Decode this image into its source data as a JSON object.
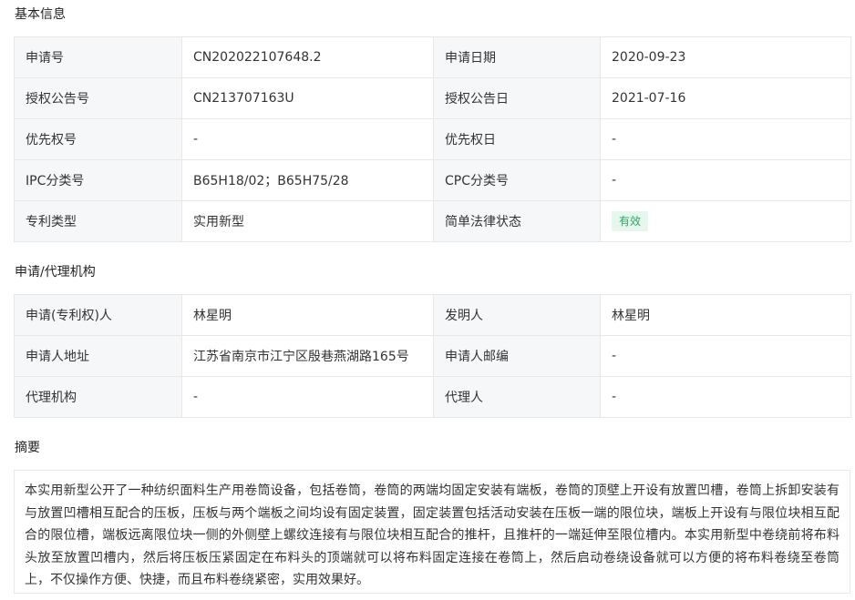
{
  "basic_info": {
    "title": "基本信息",
    "rows": [
      [
        {
          "label": "申请号",
          "value": "CN202022107648.2"
        },
        {
          "label": "申请日期",
          "value": "2020-09-23"
        }
      ],
      [
        {
          "label": "授权公告号",
          "value": "CN213707163U"
        },
        {
          "label": "授权公告日",
          "value": "2021-07-16"
        }
      ],
      [
        {
          "label": "优先权号",
          "value": "-"
        },
        {
          "label": "优先权日",
          "value": "-"
        }
      ],
      [
        {
          "label": "IPC分类号",
          "value": "B65H18/02；B65H75/28"
        },
        {
          "label": "CPC分类号",
          "value": "-"
        }
      ],
      [
        {
          "label": "专利类型",
          "value": "实用新型"
        },
        {
          "label": "简单法律状态",
          "value": "有效"
        }
      ]
    ]
  },
  "agency_info": {
    "title": "申请/代理机构",
    "rows": [
      [
        {
          "label": "申请(专利权)人",
          "value": "林星明"
        },
        {
          "label": "发明人",
          "value": "林星明"
        }
      ],
      [
        {
          "label": "申请人地址",
          "value": "江苏省南京市江宁区殷巷燕湖路165号"
        },
        {
          "label": "申请人邮编",
          "value": "-"
        }
      ],
      [
        {
          "label": "代理机构",
          "value": "-"
        },
        {
          "label": "代理人",
          "value": "-"
        }
      ]
    ]
  },
  "abstract": {
    "title": "摘要",
    "text": "本实用新型公开了一种纺织面料生产用卷筒设备，包括卷筒，卷筒的两端均固定安装有端板，卷筒的顶壁上开设有放置凹槽，卷筒上拆卸安装有与放置凹槽相互配合的压板，压板与两个端板之间均设有固定装置，固定装置包括活动安装在压板一端的限位块，端板上开设有与限位块相互配合的限位槽，端板远离限位块一侧的外侧壁上螺纹连接有与限位块相互配合的推杆，且推杆的一端延伸至限位槽内。本实用新型中卷绕前将布料头放至放置凹槽内，然后将压板压紧固定在布料头的顶端就可以将布料固定连接在卷筒上，然后启动卷绕设备就可以方便的将布料卷绕至卷筒上，不仅操作方便、快捷，而且布料卷绕紧密，实用效果好。"
  },
  "colors": {
    "label_bg": "#f6f7f9",
    "border": "#e8e8e8",
    "status_badge_bg": "#e6f7ee",
    "status_badge_text": "#2fa466"
  }
}
